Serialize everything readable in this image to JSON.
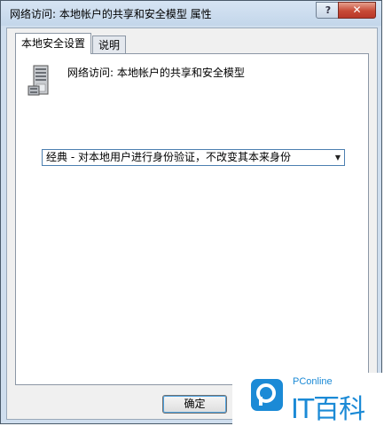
{
  "window": {
    "title": "网络访问: 本地帐户的共享和安全模型 属性",
    "help_label": "?",
    "close_label": "✕"
  },
  "tabs": [
    {
      "label": "本地安全设置",
      "active": true
    },
    {
      "label": "说明",
      "active": false
    }
  ],
  "panel": {
    "policy_icon": "server-icon",
    "policy_title": "网络访问: 本地帐户的共享和安全模型",
    "dropdown": {
      "selected": "经典 - 对本地用户进行身份验证，不改变其本来身份",
      "arrow": "▼"
    }
  },
  "buttons": {
    "ok_label": "确定"
  },
  "watermark": {
    "brand": "PConline",
    "text": "IT百科",
    "color": "#1b8ad6"
  }
}
